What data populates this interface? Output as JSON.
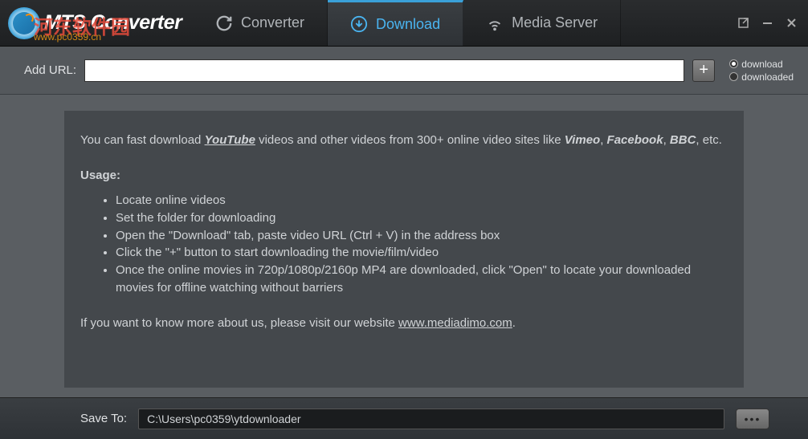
{
  "header": {
    "app_title": "MTS Converter",
    "watermark_text": "河东软件园",
    "watermark_url": "www.pc0359.cn",
    "tabs": {
      "converter": "Converter",
      "download": "Download",
      "media_server": "Media Server"
    }
  },
  "url_bar": {
    "label": "Add URL:",
    "value": "",
    "add_button": "+",
    "radio": {
      "download": "download",
      "downloaded": "downloaded"
    }
  },
  "content": {
    "intro_prefix": "You can fast download ",
    "intro_link": "YouTube",
    "intro_mid": " videos and other videos from 300+ online video sites like ",
    "site1": "Vimeo",
    "site2": "Facebook",
    "site3": "BBC",
    "intro_suffix": ", etc.",
    "usage_heading": "Usage:",
    "usage_items": [
      "Locate online videos",
      "Set the folder for downloading",
      "Open the \"Download\" tab, paste video URL (Ctrl + V) in the address box",
      "Click the \"+\" button to start downloading the movie/film/video",
      "Once the online movies in 720p/1080p/2160p MP4 are downloaded, click \"Open\" to locate your downloaded movies for offline watching without barriers"
    ],
    "website_prefix": "If you want to know more about us, please visit our website ",
    "website_link": "www.mediadimo.com",
    "website_suffix": "."
  },
  "footer": {
    "label": "Save To:",
    "path": "C:\\Users\\pc0359\\ytdownloader",
    "browse": "•••"
  }
}
